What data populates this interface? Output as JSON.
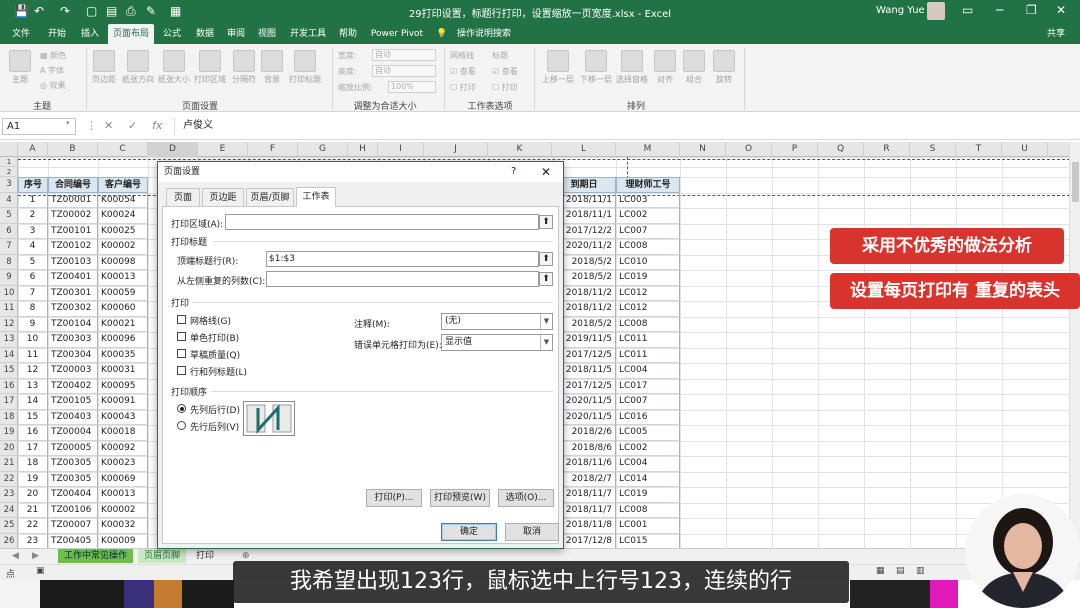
{
  "titlebar": {
    "title": "29打印设置，标题行打印，设置缩放一页宽度.xlsx - Excel",
    "user": "Wang Yue",
    "icons": [
      "save-icon",
      "undo-icon",
      "redo-icon",
      "new-icon",
      "open-icon",
      "print-icon",
      "paint-icon",
      "format-icon"
    ]
  },
  "tabs": [
    "文件",
    "开始",
    "插入",
    "页面布局",
    "公式",
    "数据",
    "审阅",
    "视图",
    "开发工具",
    "帮助",
    "Power Pivot",
    "操作说明搜索"
  ],
  "share": "共享",
  "ribbon": {
    "theme_group": {
      "label": "主题",
      "themes": "主题",
      "colors": "颜色",
      "fonts": "字体",
      "effects": "效果"
    },
    "page_setup_group": {
      "label": "页面设置",
      "buttons": [
        "页边距",
        "纸张方向",
        "纸张大小",
        "打印区域",
        "分隔符",
        "背景",
        "打印标题"
      ]
    },
    "scale_group": {
      "label": "调整为合适大小",
      "width_label": "宽度:",
      "width_val": "自动",
      "height_label": "高度:",
      "height_val": "自动",
      "scale_label": "缩放比例:",
      "scale_val": "100%"
    },
    "sheet_options_group": {
      "label": "工作表选项",
      "gridlines": "网格线",
      "headings": "标题",
      "view1": "查看",
      "view2": "查看",
      "print1": "打印",
      "print2": "打印"
    },
    "arrange_group": {
      "label": "排列",
      "buttons": [
        "上移一层",
        "下移一层",
        "选择窗格",
        "对齐",
        "组合",
        "旋转"
      ]
    }
  },
  "formula_bar": {
    "name_box": "A1",
    "cancel": "✕",
    "confirm": "✓",
    "fx": "fx",
    "value": "卢俊义"
  },
  "grid": {
    "columns": [
      "A",
      "B",
      "C",
      "D",
      "E",
      "F",
      "G",
      "H",
      "I",
      "J",
      "K",
      "L",
      "M",
      "N",
      "O",
      "P",
      "Q",
      "R",
      "S",
      "T",
      "U"
    ],
    "row_numbers": [
      "1",
      "2",
      "3",
      "4",
      "5",
      "6",
      "7",
      "8",
      "9",
      "10",
      "11",
      "12",
      "13",
      "14",
      "15",
      "16",
      "17",
      "18",
      "19",
      "20",
      "21",
      "22",
      "23",
      "24",
      "25",
      "26"
    ],
    "header_row": {
      "seq": "序号",
      "contract": "合同编号",
      "customer": "客户编号",
      "due": "到期日",
      "advisor": "理财师工号"
    },
    "rows": [
      {
        "seq": "1",
        "contract": "TZ00001",
        "customer": "K00054",
        "due": "2018/11/1",
        "advisor": "LC003"
      },
      {
        "seq": "2",
        "contract": "TZ00002",
        "customer": "K00024",
        "due": "2018/11/1",
        "advisor": "LC002"
      },
      {
        "seq": "3",
        "contract": "TZ00101",
        "customer": "K00025",
        "due": "2017/12/2",
        "advisor": "LC007"
      },
      {
        "seq": "4",
        "contract": "TZ00102",
        "customer": "K00002",
        "due": "2020/11/2",
        "advisor": "LC008"
      },
      {
        "seq": "5",
        "contract": "TZ00103",
        "customer": "K00098",
        "due": "2018/5/2",
        "advisor": "LC010"
      },
      {
        "seq": "6",
        "contract": "TZ00401",
        "customer": "K00013",
        "due": "2018/5/2",
        "advisor": "LC019"
      },
      {
        "seq": "7",
        "contract": "TZ00301",
        "customer": "K00059",
        "due": "2018/11/2",
        "advisor": "LC012"
      },
      {
        "seq": "8",
        "contract": "TZ00302",
        "customer": "K00060",
        "due": "2018/11/2",
        "advisor": "LC012"
      },
      {
        "seq": "9",
        "contract": "TZ00104",
        "customer": "K00021",
        "due": "2018/5/2",
        "advisor": "LC008"
      },
      {
        "seq": "10",
        "contract": "TZ00303",
        "customer": "K00096",
        "due": "2019/11/5",
        "advisor": "LC011"
      },
      {
        "seq": "11",
        "contract": "TZ00304",
        "customer": "K00035",
        "due": "2017/12/5",
        "advisor": "LC011"
      },
      {
        "seq": "12",
        "contract": "TZ00003",
        "customer": "K00031",
        "due": "2018/11/5",
        "advisor": "LC004"
      },
      {
        "seq": "13",
        "contract": "TZ00402",
        "customer": "K00095",
        "due": "2017/12/5",
        "advisor": "LC017"
      },
      {
        "seq": "14",
        "contract": "TZ00105",
        "customer": "K00091",
        "due": "2020/11/5",
        "advisor": "LC007"
      },
      {
        "seq": "15",
        "contract": "TZ00403",
        "customer": "K00043",
        "due": "2020/11/5",
        "advisor": "LC016"
      },
      {
        "seq": "16",
        "contract": "TZ00004",
        "customer": "K00018",
        "due": "2018/2/6",
        "advisor": "LC005"
      },
      {
        "seq": "17",
        "contract": "TZ00005",
        "customer": "K00092",
        "due": "2018/8/6",
        "advisor": "LC002"
      },
      {
        "seq": "18",
        "contract": "TZ00305",
        "customer": "K00023",
        "due": "2018/11/6",
        "advisor": "LC004"
      },
      {
        "seq": "19",
        "contract": "TZ00305",
        "customer": "K00069",
        "due": "2018/2/7",
        "advisor": "LC014"
      },
      {
        "seq": "20",
        "contract": "TZ00404",
        "customer": "K00013",
        "due": "2018/11/7",
        "advisor": "LC019"
      },
      {
        "seq": "21",
        "contract": "TZ00106",
        "customer": "K00002",
        "due": "2018/11/7",
        "advisor": "LC008"
      },
      {
        "seq": "22",
        "contract": "TZ00007",
        "customer": "K00032",
        "due": "2018/11/8",
        "advisor": "LC001"
      },
      {
        "seq": "23",
        "contract": "TZ00405",
        "customer": "K00009",
        "due": "2017/12/8",
        "advisor": "LC015"
      }
    ]
  },
  "sheet_tabs": [
    "工作中常见操作",
    "页眉页脚",
    "打印"
  ],
  "add_sheet": "⊕",
  "status": {
    "mode": "点"
  },
  "dialog": {
    "title": "页面设置",
    "help": "?",
    "close": "✕",
    "tabs": [
      "页面",
      "页边距",
      "页眉/页脚",
      "工作表"
    ],
    "print_area_label": "打印区域(A):",
    "print_area_value": "",
    "print_titles_section": "打印标题",
    "rows_repeat_label": "顶端标题行(R):",
    "rows_repeat_value": "$1:$3",
    "cols_repeat_label": "从左侧重复的列数(C):",
    "cols_repeat_value": "",
    "print_section": "打印",
    "checkboxes": [
      "网格线(G)",
      "单色打印(B)",
      "草稿质量(Q)",
      "行和列标题(L)"
    ],
    "comments_label": "注释(M):",
    "comments_value": "(无)",
    "errors_label": "错误单元格打印为(E):",
    "errors_value": "显示值",
    "order_section": "打印顺序",
    "order_options": [
      "先列后行(D)",
      "先行后列(V)"
    ],
    "print_btn": "打印(P)...",
    "preview_btn": "打印预览(W)",
    "options_btn": "选项(O)...",
    "ok_btn": "确定",
    "cancel_btn": "取消"
  },
  "overlays": {
    "banner1": "采用不优秀的做法分析",
    "banner2": "设置每页打印有 重复的表头",
    "subtitle": "我希望出现123行，鼠标选中上行号123，连续的行"
  },
  "colors": {
    "excel_green": "#217346",
    "banner_red": "#d8342d",
    "header_fill": "#dae6f0"
  }
}
